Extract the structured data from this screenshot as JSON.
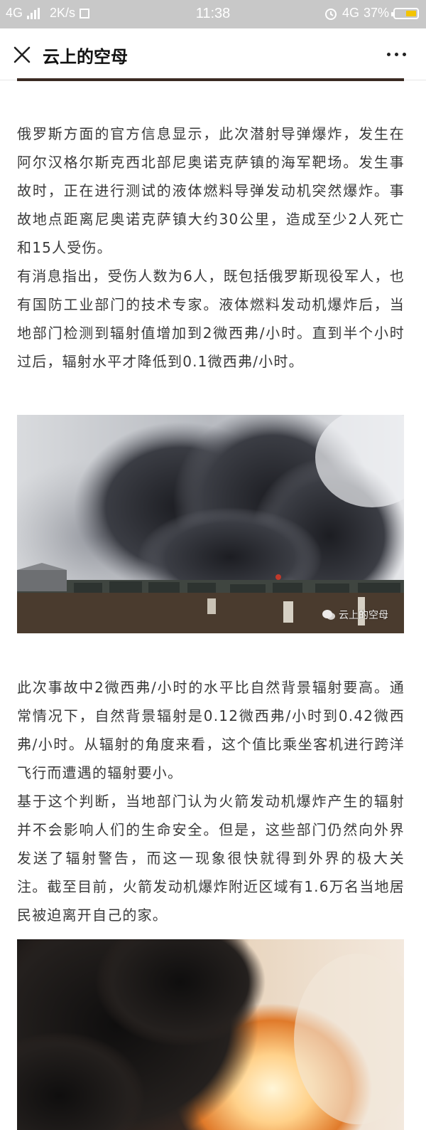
{
  "status_bar": {
    "network_left": "4G",
    "speed": "2K/s",
    "time": "11:38",
    "network_right": "4G",
    "battery": "37%"
  },
  "nav": {
    "title": "云上的空母"
  },
  "article": {
    "paragraphs": [
      "俄罗斯方面的官方信息显示，此次潜射导弹爆炸，发生在阿尔汉格尔斯克西北部尼奥诺克萨镇的海军靶场。发生事故时，正在进行测试的液体燃料导弹发动机突然爆炸。事故地点距离尼奥诺克萨镇大约30公里，造成至少2人死亡和15人受伤。",
      "有消息指出，受伤人数为6人，既包括俄罗斯现役军人，也有国防工业部门的技术专家。液体燃料发动机爆炸后，当地部门检测到辐射值增加到2微西弗/小时。直到半个小时过后，辐射水平才降低到0.1微西弗/小时。",
      "此次事故中2微西弗/小时的水平比自然背景辐射要高。通常情况下，自然背景辐射是0.12微西弗/小时到0.42微西弗/小时。从辐射的角度来看，这个值比乘坐客机进行跨洋飞行而遭遇的辐射要小。",
      "基于这个判断，当地部门认为火箭发动机爆炸产生的辐射并不会影响人们的生命安全。但是，这些部门仍然向外界发送了辐射警告，而这一现象很快就得到外界的极大关注。截至目前，火箭发动机爆炸附近区域有1.6万名当地居民被迫离开自己的家。"
    ],
    "image_watermark": "云上的空母"
  },
  "icons": {
    "close": "close-icon",
    "more": "more-dots-icon",
    "alarm": "alarm-icon",
    "battery": "battery-icon",
    "wechat": "wechat-icon"
  },
  "colors": {
    "status_bar_bg": "#c8c8c8",
    "battery_fill": "#f3c400",
    "text": "#3a3a3a"
  }
}
